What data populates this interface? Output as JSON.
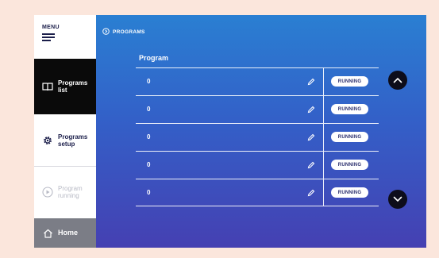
{
  "sidebar": {
    "menu_label": "MENU",
    "items": [
      {
        "label_line1": "Programs",
        "label_line2": "list",
        "icon": "book-icon",
        "state": "active"
      },
      {
        "label_line1": "Programs",
        "label_line2": "setup",
        "icon": "gear-icon",
        "state": "normal"
      },
      {
        "label_line1": "Program",
        "label_line2": "running",
        "icon": "play-circle-icon",
        "state": "disabled"
      },
      {
        "label_line1": "Home",
        "icon": "home-icon",
        "state": "normal"
      }
    ]
  },
  "main": {
    "breadcrumb": "PROGRAMS",
    "column_header": "Program",
    "rows": [
      {
        "value": "0",
        "status": "RUNNING"
      },
      {
        "value": "0",
        "status": "RUNNING"
      },
      {
        "value": "0",
        "status": "RUNNING"
      },
      {
        "value": "0",
        "status": "RUNNING"
      },
      {
        "value": "0",
        "status": "RUNNING"
      }
    ]
  },
  "colors": {
    "page_background": "#fbe6dc",
    "gradient_top": "#2a7fd2",
    "gradient_bottom": "#4540b2",
    "active_item": "#0a0a0a",
    "home_item": "#7b7d86",
    "badge_bg": "#ffffff"
  }
}
